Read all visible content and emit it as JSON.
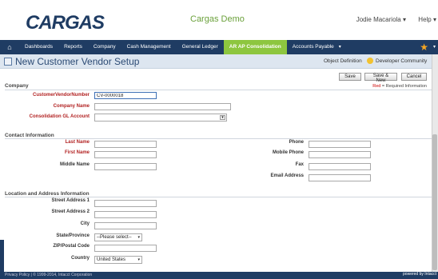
{
  "header": {
    "logo_text": "CARGAS",
    "app_title": "Cargas Demo",
    "user": "Jodie Macariola",
    "help": "Help"
  },
  "nav": {
    "items": [
      "Dashboards",
      "Reports",
      "Company",
      "Cash Management",
      "General Ledger",
      "AR AP Consolidation",
      "Accounts Payable"
    ]
  },
  "titlebar": {
    "title": "New Customer Vendor Setup",
    "object_definition": "Object Definition",
    "developer_community": "Developer Community"
  },
  "buttons": {
    "save": "Save",
    "save_new": "Save & New",
    "cancel": "Cancel"
  },
  "required_note": {
    "red": "Red",
    "rest": " = Required Information"
  },
  "company": {
    "section": "Company",
    "cvn_label": "CustomerVendorNumber",
    "cvn_value": "CV-0000018",
    "name_label": "Company Name",
    "gl_label": "Consolidation GL Account"
  },
  "contact": {
    "section": "Contact Information",
    "last_name": "Last Name",
    "first_name": "First Name",
    "middle_name": "Middle Name",
    "phone": "Phone",
    "mobile_phone": "Mobile Phone",
    "fax": "Fax",
    "email": "Email Address"
  },
  "location": {
    "section": "Location and Address Information",
    "street1": "Street Address 1",
    "street2": "Street Address 2",
    "city": "City",
    "state": "State/Province",
    "state_value": "--Please select--",
    "zip": "ZIP/Postal Code",
    "country": "Country",
    "country_value": "United States"
  },
  "footer": {
    "text": "Privacy Policy | © 1999-2014, Intacct Corporation",
    "powered": "powered by Intacct"
  }
}
